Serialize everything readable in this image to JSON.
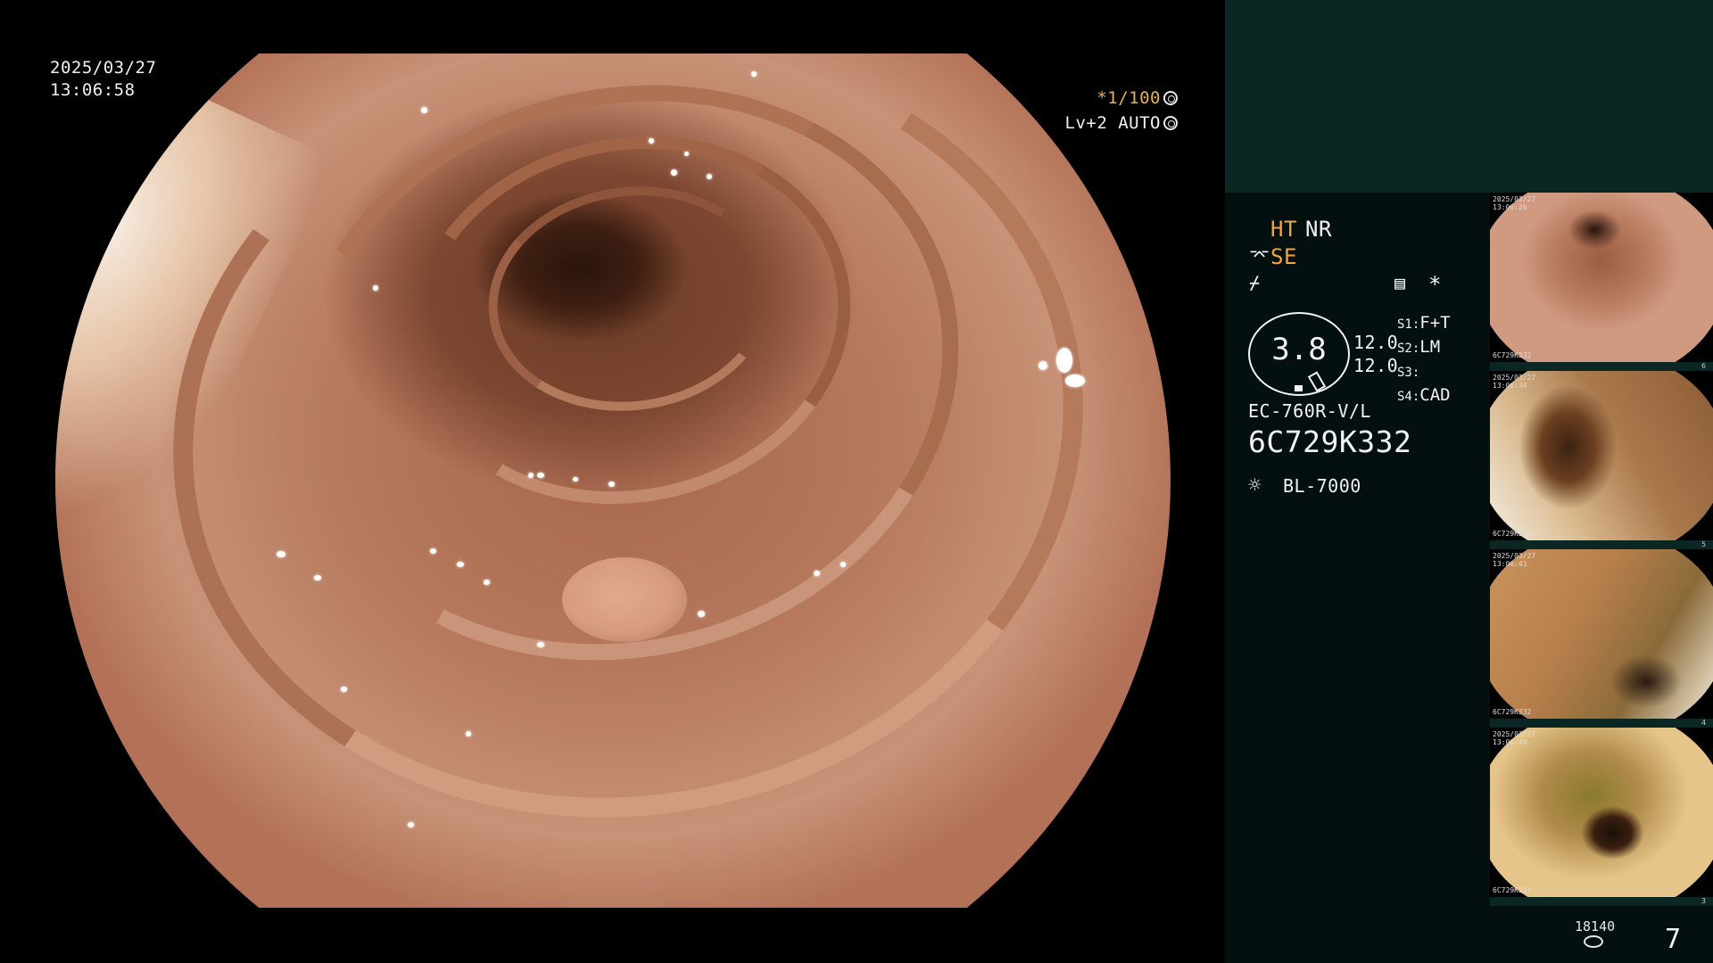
{
  "overlay": {
    "date": "2025/03/27",
    "time": "13:06:58",
    "zoom": "*1/100",
    "zoom_icon": "shutter-icon",
    "level": "Lv+2 AUTO",
    "level_icon": "auto-brightness-icon"
  },
  "panel": {
    "ht": "HT",
    "nr": "NR",
    "se": "SE",
    "se_icon": "structure-enhance-icon",
    "color_icon": "color-mode-icon",
    "menu_icon": "settings-sheet-icon",
    "star": "*",
    "scope_value": "3.8",
    "val1": "12.0",
    "val2": "12.0",
    "s1_label": "S1:",
    "s1_value": "F+T",
    "s2_label": "S2:",
    "s2_value": "LM",
    "s3_label": "S3:",
    "s3_value": "",
    "s4_label": "S4:",
    "s4_value": "CAD",
    "scope_model": "EC-760R-V/L",
    "serial": "6C729K332",
    "light_source_icon": "light-bulb-icon",
    "light_source": "BL-7000"
  },
  "thumbnails": [
    {
      "caption_top": "2025/03/27\n13:06:26",
      "caption_bottom": "6C729K332",
      "num": "6"
    },
    {
      "caption_top": "2025/03/27\n13:06:34",
      "caption_bottom": "6C729K332",
      "num": "5"
    },
    {
      "caption_top": "2025/03/27\n13:06:41",
      "caption_bottom": "6C729K332",
      "num": "4"
    },
    {
      "caption_top": "2025/03/27\n13:06:49",
      "caption_bottom": "6C729K332",
      "num": "3"
    }
  ],
  "footer": {
    "count": "18140",
    "disk_icon": "storage-disk-icon",
    "image_index": "7"
  }
}
